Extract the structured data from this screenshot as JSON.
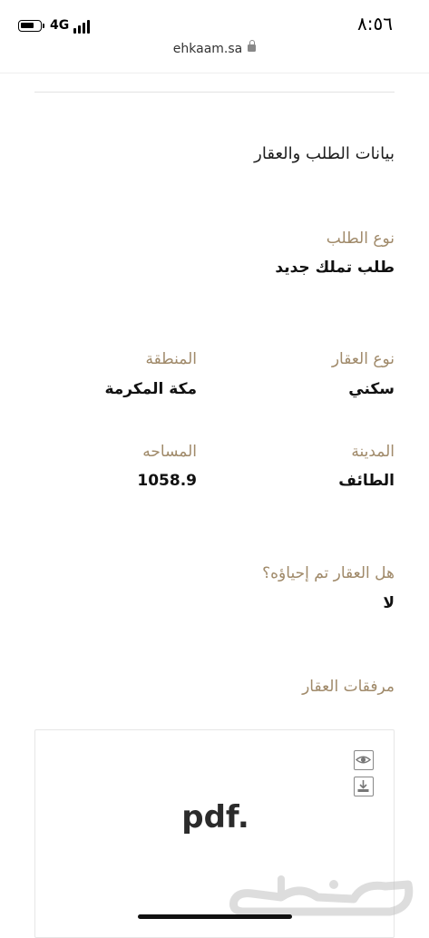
{
  "status_bar": {
    "network": "4G",
    "time": "٨:٥٦"
  },
  "browser": {
    "url": "ehkaam.sa"
  },
  "section": {
    "title": "بيانات الطلب والعقار"
  },
  "request_type": {
    "label": "نوع الطلب",
    "value": "طلب تملك جديد"
  },
  "property_type": {
    "label": "نوع العقار",
    "value": "سكني"
  },
  "region": {
    "label": "المنطقة",
    "value": "مكة المكرمة"
  },
  "city": {
    "label": "المدينة",
    "value": "الطائف"
  },
  "area": {
    "label": "المساحه",
    "value": "1058.9"
  },
  "revived": {
    "label": "هل العقار تم إحياؤه؟",
    "value": "لا"
  },
  "attachments": {
    "label": "مرفقات العقار",
    "file_type": "pdf.",
    "view_icon": "eye-icon",
    "download_icon": "download-icon"
  },
  "colors": {
    "label": "#a08a6a",
    "value": "#111111",
    "border": "#e6e6e6"
  },
  "watermark": {
    "text": "حراج"
  }
}
